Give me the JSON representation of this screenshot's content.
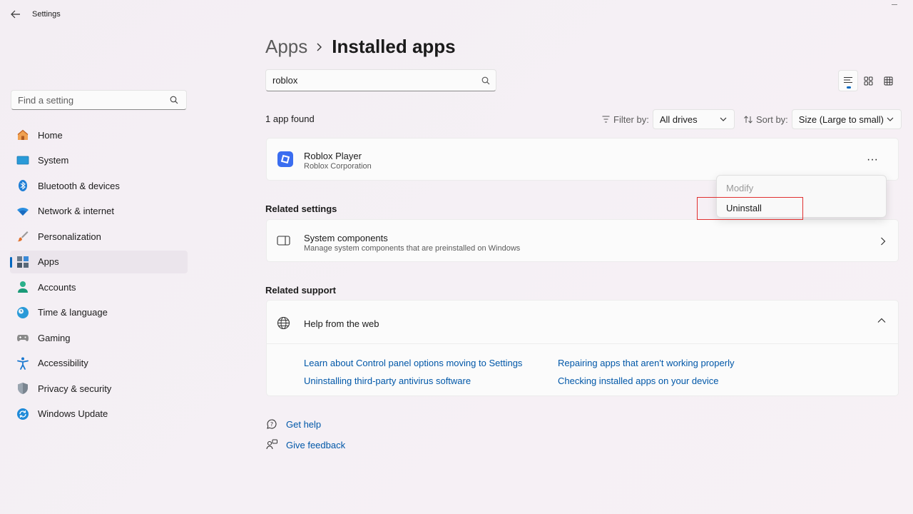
{
  "window": {
    "title": "Settings"
  },
  "sidebar": {
    "search_placeholder": "Find a setting",
    "items": [
      {
        "label": "Home",
        "icon": "home-icon"
      },
      {
        "label": "System",
        "icon": "system-icon"
      },
      {
        "label": "Bluetooth & devices",
        "icon": "bluetooth-icon"
      },
      {
        "label": "Network & internet",
        "icon": "wifi-icon"
      },
      {
        "label": "Personalization",
        "icon": "brush-icon"
      },
      {
        "label": "Apps",
        "icon": "apps-icon",
        "active": true
      },
      {
        "label": "Accounts",
        "icon": "account-icon"
      },
      {
        "label": "Time & language",
        "icon": "globe-clock-icon"
      },
      {
        "label": "Gaming",
        "icon": "gamepad-icon"
      },
      {
        "label": "Accessibility",
        "icon": "accessibility-icon"
      },
      {
        "label": "Privacy & security",
        "icon": "shield-icon"
      },
      {
        "label": "Windows Update",
        "icon": "update-icon"
      }
    ]
  },
  "main": {
    "breadcrumb": {
      "parent": "Apps",
      "current": "Installed apps"
    },
    "search_value": "roblox",
    "result_count": "1 app found",
    "filter": {
      "label": "Filter by:",
      "value": "All drives"
    },
    "sort": {
      "label": "Sort by:",
      "value": "Size (Large to small)"
    },
    "app": {
      "name": "Roblox Player",
      "publisher": "Roblox Corporation",
      "more": "···"
    },
    "context_menu": {
      "modify": "Modify",
      "uninstall": "Uninstall"
    },
    "related_settings": {
      "title": "Related settings",
      "item": {
        "title": "System components",
        "desc": "Manage system components that are preinstalled on Windows"
      }
    },
    "related_support": {
      "title": "Related support",
      "help_title": "Help from the web",
      "links": [
        "Learn about Control panel options moving to Settings",
        "Repairing apps that aren't working properly",
        "Uninstalling third-party antivirus software",
        "Checking installed apps on your device"
      ]
    },
    "footer": {
      "get_help": "Get help",
      "give_feedback": "Give feedback"
    }
  },
  "colors": {
    "accent": "#0067c0",
    "link": "#0057a8",
    "highlight": "#e03030",
    "roblox": "#3a6df0"
  }
}
